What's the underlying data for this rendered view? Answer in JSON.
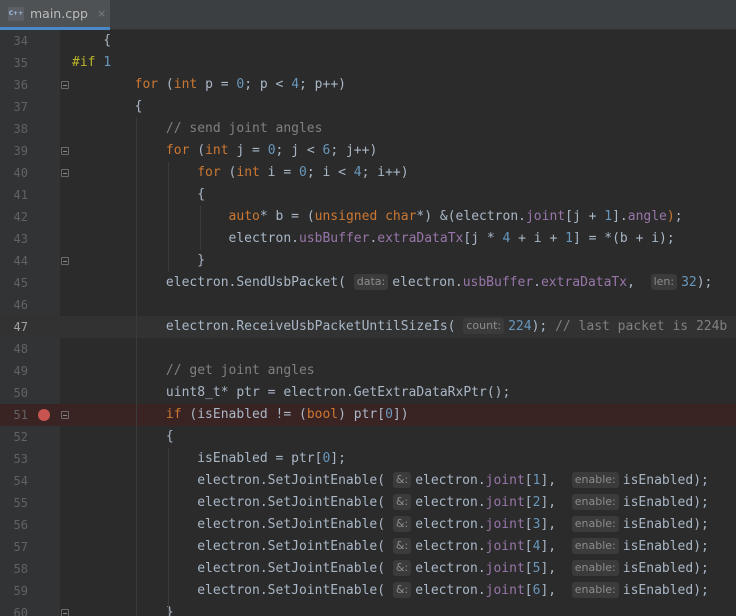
{
  "tab": {
    "title": "main.cpp",
    "close": "×",
    "icon_text": "C++"
  },
  "colors": {
    "background": "#2b2b2b",
    "keyword": "#cc7832",
    "number": "#6897bb",
    "comment": "#808080",
    "field": "#9876aa",
    "text": "#a9b7c6",
    "breakpoint": "#c75450"
  },
  "lines": [
    {
      "num": "34",
      "fold": "",
      "bp": false,
      "current": false,
      "tokens": [
        [
          "",
          "    {"
        ]
      ]
    },
    {
      "num": "35",
      "fold": "",
      "bp": false,
      "current": false,
      "tokens": [
        [
          "macro",
          "#if"
        ],
        [
          "",
          " "
        ],
        [
          "num-lit",
          "1"
        ]
      ]
    },
    {
      "num": "36",
      "fold": "open",
      "bp": false,
      "current": false,
      "tokens": [
        [
          "",
          "        "
        ],
        [
          "kw",
          "for"
        ],
        [
          "",
          " ("
        ],
        [
          "kw",
          "int"
        ],
        [
          "",
          " p = "
        ],
        [
          "num-lit",
          "0"
        ],
        [
          "",
          "; p < "
        ],
        [
          "num-lit",
          "4"
        ],
        [
          "",
          "; p++)"
        ]
      ]
    },
    {
      "num": "37",
      "fold": "",
      "bp": false,
      "current": false,
      "tokens": [
        [
          "",
          "        {"
        ]
      ]
    },
    {
      "num": "38",
      "fold": "",
      "bp": false,
      "current": false,
      "tokens": [
        [
          "",
          "            "
        ],
        [
          "cmt",
          "// send joint angles"
        ]
      ]
    },
    {
      "num": "39",
      "fold": "open",
      "bp": false,
      "current": false,
      "tokens": [
        [
          "",
          "            "
        ],
        [
          "kw",
          "for"
        ],
        [
          "",
          " ("
        ],
        [
          "kw",
          "int"
        ],
        [
          "",
          " j = "
        ],
        [
          "num-lit",
          "0"
        ],
        [
          "",
          "; j < "
        ],
        [
          "num-lit",
          "6"
        ],
        [
          "",
          "; j++)"
        ]
      ]
    },
    {
      "num": "40",
      "fold": "open",
      "bp": false,
      "current": false,
      "tokens": [
        [
          "",
          "                "
        ],
        [
          "kw",
          "for"
        ],
        [
          "",
          " ("
        ],
        [
          "kw",
          "int"
        ],
        [
          "",
          " i = "
        ],
        [
          "num-lit",
          "0"
        ],
        [
          "",
          "; i < "
        ],
        [
          "num-lit",
          "4"
        ],
        [
          "",
          "; i++)"
        ]
      ]
    },
    {
      "num": "41",
      "fold": "",
      "bp": false,
      "current": false,
      "tokens": [
        [
          "",
          "                {"
        ]
      ]
    },
    {
      "num": "42",
      "fold": "",
      "bp": false,
      "current": false,
      "tokens": [
        [
          "",
          "                    "
        ],
        [
          "kw",
          "auto"
        ],
        [
          "",
          "* b = ("
        ],
        [
          "kw",
          "unsigned char"
        ],
        [
          "",
          "*) &(electron."
        ],
        [
          "field",
          "joint"
        ],
        [
          "",
          "[j + "
        ],
        [
          "num-lit",
          "1"
        ],
        [
          "",
          "]."
        ],
        [
          "field",
          "angle"
        ],
        [
          "kw",
          ")"
        ],
        [
          "",
          ";"
        ]
      ]
    },
    {
      "num": "43",
      "fold": "",
      "bp": false,
      "current": false,
      "tokens": [
        [
          "",
          "                    electron."
        ],
        [
          "field",
          "usbBuffer"
        ],
        [
          "",
          "."
        ],
        [
          "field",
          "extraDataTx"
        ],
        [
          "",
          "[j * "
        ],
        [
          "num-lit",
          "4"
        ],
        [
          "",
          " + i + "
        ],
        [
          "num-lit",
          "1"
        ],
        [
          "",
          "] = *(b + i);"
        ]
      ]
    },
    {
      "num": "44",
      "fold": "closed",
      "bp": false,
      "current": false,
      "tokens": [
        [
          "",
          "                }"
        ]
      ]
    },
    {
      "num": "45",
      "fold": "",
      "bp": false,
      "current": false,
      "tokens": [
        [
          "",
          "            electron.SendUsbPacket( "
        ],
        [
          "hint",
          "data:"
        ],
        [
          "",
          "electron."
        ],
        [
          "field",
          "usbBuffer"
        ],
        [
          "",
          "."
        ],
        [
          "field",
          "extraDataTx"
        ],
        [
          "",
          ",  "
        ],
        [
          "hint",
          "len:"
        ],
        [
          "num-lit",
          "32"
        ],
        [
          "",
          ");"
        ]
      ]
    },
    {
      "num": "46",
      "fold": "",
      "bp": false,
      "current": false,
      "tokens": [
        [
          "",
          ""
        ]
      ]
    },
    {
      "num": "47",
      "fold": "",
      "bp": false,
      "current": true,
      "tokens": [
        [
          "",
          "            electron.ReceiveUsbPacketUntilSizeIs( "
        ],
        [
          "hint",
          "count:"
        ],
        [
          "num-lit",
          "224"
        ],
        [
          "",
          "); "
        ],
        [
          "cmt",
          "// last packet is 224b"
        ]
      ]
    },
    {
      "num": "48",
      "fold": "",
      "bp": false,
      "current": false,
      "tokens": [
        [
          "",
          ""
        ]
      ]
    },
    {
      "num": "49",
      "fold": "",
      "bp": false,
      "current": false,
      "tokens": [
        [
          "",
          "            "
        ],
        [
          "cmt",
          "// get joint angles"
        ]
      ]
    },
    {
      "num": "50",
      "fold": "",
      "bp": false,
      "current": false,
      "tokens": [
        [
          "",
          "            uint8_t* ptr = electron.GetExtraDataRxPtr();"
        ]
      ]
    },
    {
      "num": "51",
      "fold": "open",
      "bp": true,
      "current": false,
      "tokens": [
        [
          "",
          "            "
        ],
        [
          "kw",
          "if"
        ],
        [
          "",
          " (isEnabled != ("
        ],
        [
          "kw",
          "bool"
        ],
        [
          "",
          ") ptr["
        ],
        [
          "num-lit",
          "0"
        ],
        [
          "",
          "])"
        ]
      ]
    },
    {
      "num": "52",
      "fold": "",
      "bp": false,
      "current": false,
      "tokens": [
        [
          "",
          "            {"
        ]
      ]
    },
    {
      "num": "53",
      "fold": "",
      "bp": false,
      "current": false,
      "tokens": [
        [
          "",
          "                isEnabled = ptr["
        ],
        [
          "num-lit",
          "0"
        ],
        [
          "",
          "];"
        ]
      ]
    },
    {
      "num": "54",
      "fold": "",
      "bp": false,
      "current": false,
      "tokens": [
        [
          "",
          "                electron.SetJointEnable( "
        ],
        [
          "hint",
          "&:"
        ],
        [
          "",
          "electron."
        ],
        [
          "field",
          "joint"
        ],
        [
          "",
          "["
        ],
        [
          "num-lit",
          "1"
        ],
        [
          "",
          "],  "
        ],
        [
          "hint",
          "enable:"
        ],
        [
          "",
          "isEnabled);"
        ]
      ]
    },
    {
      "num": "55",
      "fold": "",
      "bp": false,
      "current": false,
      "tokens": [
        [
          "",
          "                electron.SetJointEnable( "
        ],
        [
          "hint",
          "&:"
        ],
        [
          "",
          "electron."
        ],
        [
          "field",
          "joint"
        ],
        [
          "",
          "["
        ],
        [
          "num-lit",
          "2"
        ],
        [
          "",
          "],  "
        ],
        [
          "hint",
          "enable:"
        ],
        [
          "",
          "isEnabled);"
        ]
      ]
    },
    {
      "num": "56",
      "fold": "",
      "bp": false,
      "current": false,
      "tokens": [
        [
          "",
          "                electron.SetJointEnable( "
        ],
        [
          "hint",
          "&:"
        ],
        [
          "",
          "electron."
        ],
        [
          "field",
          "joint"
        ],
        [
          "",
          "["
        ],
        [
          "num-lit",
          "3"
        ],
        [
          "",
          "],  "
        ],
        [
          "hint",
          "enable:"
        ],
        [
          "",
          "isEnabled);"
        ]
      ]
    },
    {
      "num": "57",
      "fold": "",
      "bp": false,
      "current": false,
      "tokens": [
        [
          "",
          "                electron.SetJointEnable( "
        ],
        [
          "hint",
          "&:"
        ],
        [
          "",
          "electron."
        ],
        [
          "field",
          "joint"
        ],
        [
          "",
          "["
        ],
        [
          "num-lit",
          "4"
        ],
        [
          "",
          "],  "
        ],
        [
          "hint",
          "enable:"
        ],
        [
          "",
          "isEnabled);"
        ]
      ]
    },
    {
      "num": "58",
      "fold": "",
      "bp": false,
      "current": false,
      "tokens": [
        [
          "",
          "                electron.SetJointEnable( "
        ],
        [
          "hint",
          "&:"
        ],
        [
          "",
          "electron."
        ],
        [
          "field",
          "joint"
        ],
        [
          "",
          "["
        ],
        [
          "num-lit",
          "5"
        ],
        [
          "",
          "],  "
        ],
        [
          "hint",
          "enable:"
        ],
        [
          "",
          "isEnabled);"
        ]
      ]
    },
    {
      "num": "59",
      "fold": "",
      "bp": false,
      "current": false,
      "tokens": [
        [
          "",
          "                electron.SetJointEnable( "
        ],
        [
          "hint",
          "&:"
        ],
        [
          "",
          "electron."
        ],
        [
          "field",
          "joint"
        ],
        [
          "",
          "["
        ],
        [
          "num-lit",
          "6"
        ],
        [
          "",
          "],  "
        ],
        [
          "hint",
          "enable:"
        ],
        [
          "",
          "isEnabled);"
        ]
      ]
    },
    {
      "num": "60",
      "fold": "closed",
      "bp": false,
      "current": false,
      "tokens": [
        [
          "",
          "            }"
        ]
      ]
    }
  ]
}
